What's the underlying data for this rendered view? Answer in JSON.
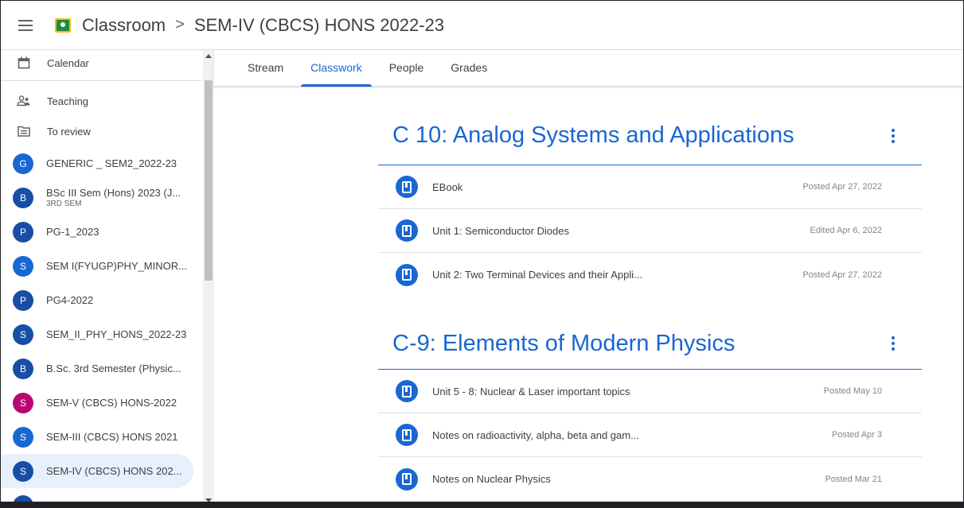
{
  "header": {
    "app_name": "Classroom",
    "separator": ">",
    "class_name": "SEM-IV (CBCS) HONS 2022-23"
  },
  "sidebar": {
    "calendar": "Calendar",
    "teaching": "Teaching",
    "to_review": "To review",
    "classes": [
      {
        "letter": "G",
        "name": "GENERIC _ SEM2_2022-23",
        "sub": "",
        "color": "#1967d2"
      },
      {
        "letter": "B",
        "name": "BSc III Sem (Hons) 2023 (J...",
        "sub": "3RD SEM",
        "color": "#174ea6"
      },
      {
        "letter": "P",
        "name": "PG-1_2023",
        "sub": "",
        "color": "#174ea6"
      },
      {
        "letter": "S",
        "name": "SEM I(FYUGP)PHY_MINOR...",
        "sub": "",
        "color": "#1967d2"
      },
      {
        "letter": "P",
        "name": "PG4-2022",
        "sub": "",
        "color": "#174ea6"
      },
      {
        "letter": "S",
        "name": "SEM_II_PHY_HONS_2022-23",
        "sub": "",
        "color": "#174ea6"
      },
      {
        "letter": "B",
        "name": "B.Sc. 3rd Semester (Physic...",
        "sub": "",
        "color": "#174ea6"
      },
      {
        "letter": "S",
        "name": "SEM-V (CBCS) HONS-2022",
        "sub": "",
        "color": "#b80672"
      },
      {
        "letter": "S",
        "name": "SEM-III (CBCS) HONS 2021",
        "sub": "",
        "color": "#1967d2"
      },
      {
        "letter": "S",
        "name": "SEM-IV (CBCS) HONS 202...",
        "sub": "",
        "color": "#174ea6"
      }
    ]
  },
  "tabs": [
    "Stream",
    "Classwork",
    "People",
    "Grades"
  ],
  "topics": [
    {
      "title": "C 10: Analog Systems and Applications",
      "items": [
        {
          "title": "EBook",
          "date": "Posted Apr 27, 2022"
        },
        {
          "title": "Unit 1: Semiconductor Diodes",
          "date": "Edited Apr 6, 2022"
        },
        {
          "title": "Unit 2: Two Terminal Devices and their Appli...",
          "date": "Posted Apr 27, 2022"
        }
      ]
    },
    {
      "title": "C-9: Elements of Modern Physics",
      "items": [
        {
          "title": "Unit 5 - 8: Nuclear & Laser important topics",
          "date": "Posted May 10"
        },
        {
          "title": "Notes on radioactivity, alpha, beta and gam...",
          "date": "Posted Apr 3"
        },
        {
          "title": "Notes on Nuclear Physics",
          "date": "Posted Mar 21"
        }
      ]
    }
  ],
  "colors": {
    "accent": "#1967d2",
    "active_bg": "#e8f0fe"
  }
}
